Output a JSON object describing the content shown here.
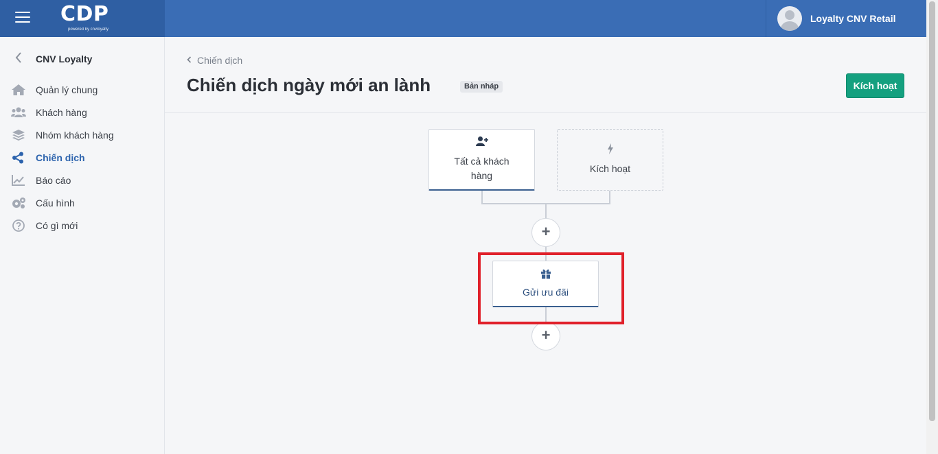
{
  "topbar": {
    "logo_text": "CDP",
    "logo_sub": "powered by cnvloyalty",
    "user_name": "Loyalty CNV Retail"
  },
  "sidebar": {
    "title": "CNV Loyalty",
    "items": [
      {
        "label": "Quản lý chung",
        "icon": "home-icon"
      },
      {
        "label": "Khách hàng",
        "icon": "users-icon"
      },
      {
        "label": "Nhóm khách hàng",
        "icon": "layers-icon"
      },
      {
        "label": "Chiến dịch",
        "icon": "share-icon",
        "active": true
      },
      {
        "label": "Báo cáo",
        "icon": "chart-line-icon"
      },
      {
        "label": "Cấu hình",
        "icon": "cogs-icon"
      },
      {
        "label": "Có gì mới",
        "icon": "question-circle-icon"
      }
    ]
  },
  "header": {
    "breadcrumb": "Chiến dịch",
    "title": "Chiến dịch ngày mới an lành",
    "badge": "Bản nháp",
    "activate_label": "Kích hoạt"
  },
  "flow": {
    "audience_node": {
      "label": "Tất cả khách hàng",
      "icon": "user-plus-icon"
    },
    "trigger_node": {
      "label": "Kích hoạt",
      "icon": "bolt-icon"
    },
    "action_node": {
      "label": "Gửi ưu đãi",
      "icon": "gift-icon"
    },
    "add_symbol": "+"
  },
  "colors": {
    "topbar": "#3a6db5",
    "accent": "#2c63ad",
    "activate": "#14a07f",
    "highlight": "#e0202a"
  }
}
